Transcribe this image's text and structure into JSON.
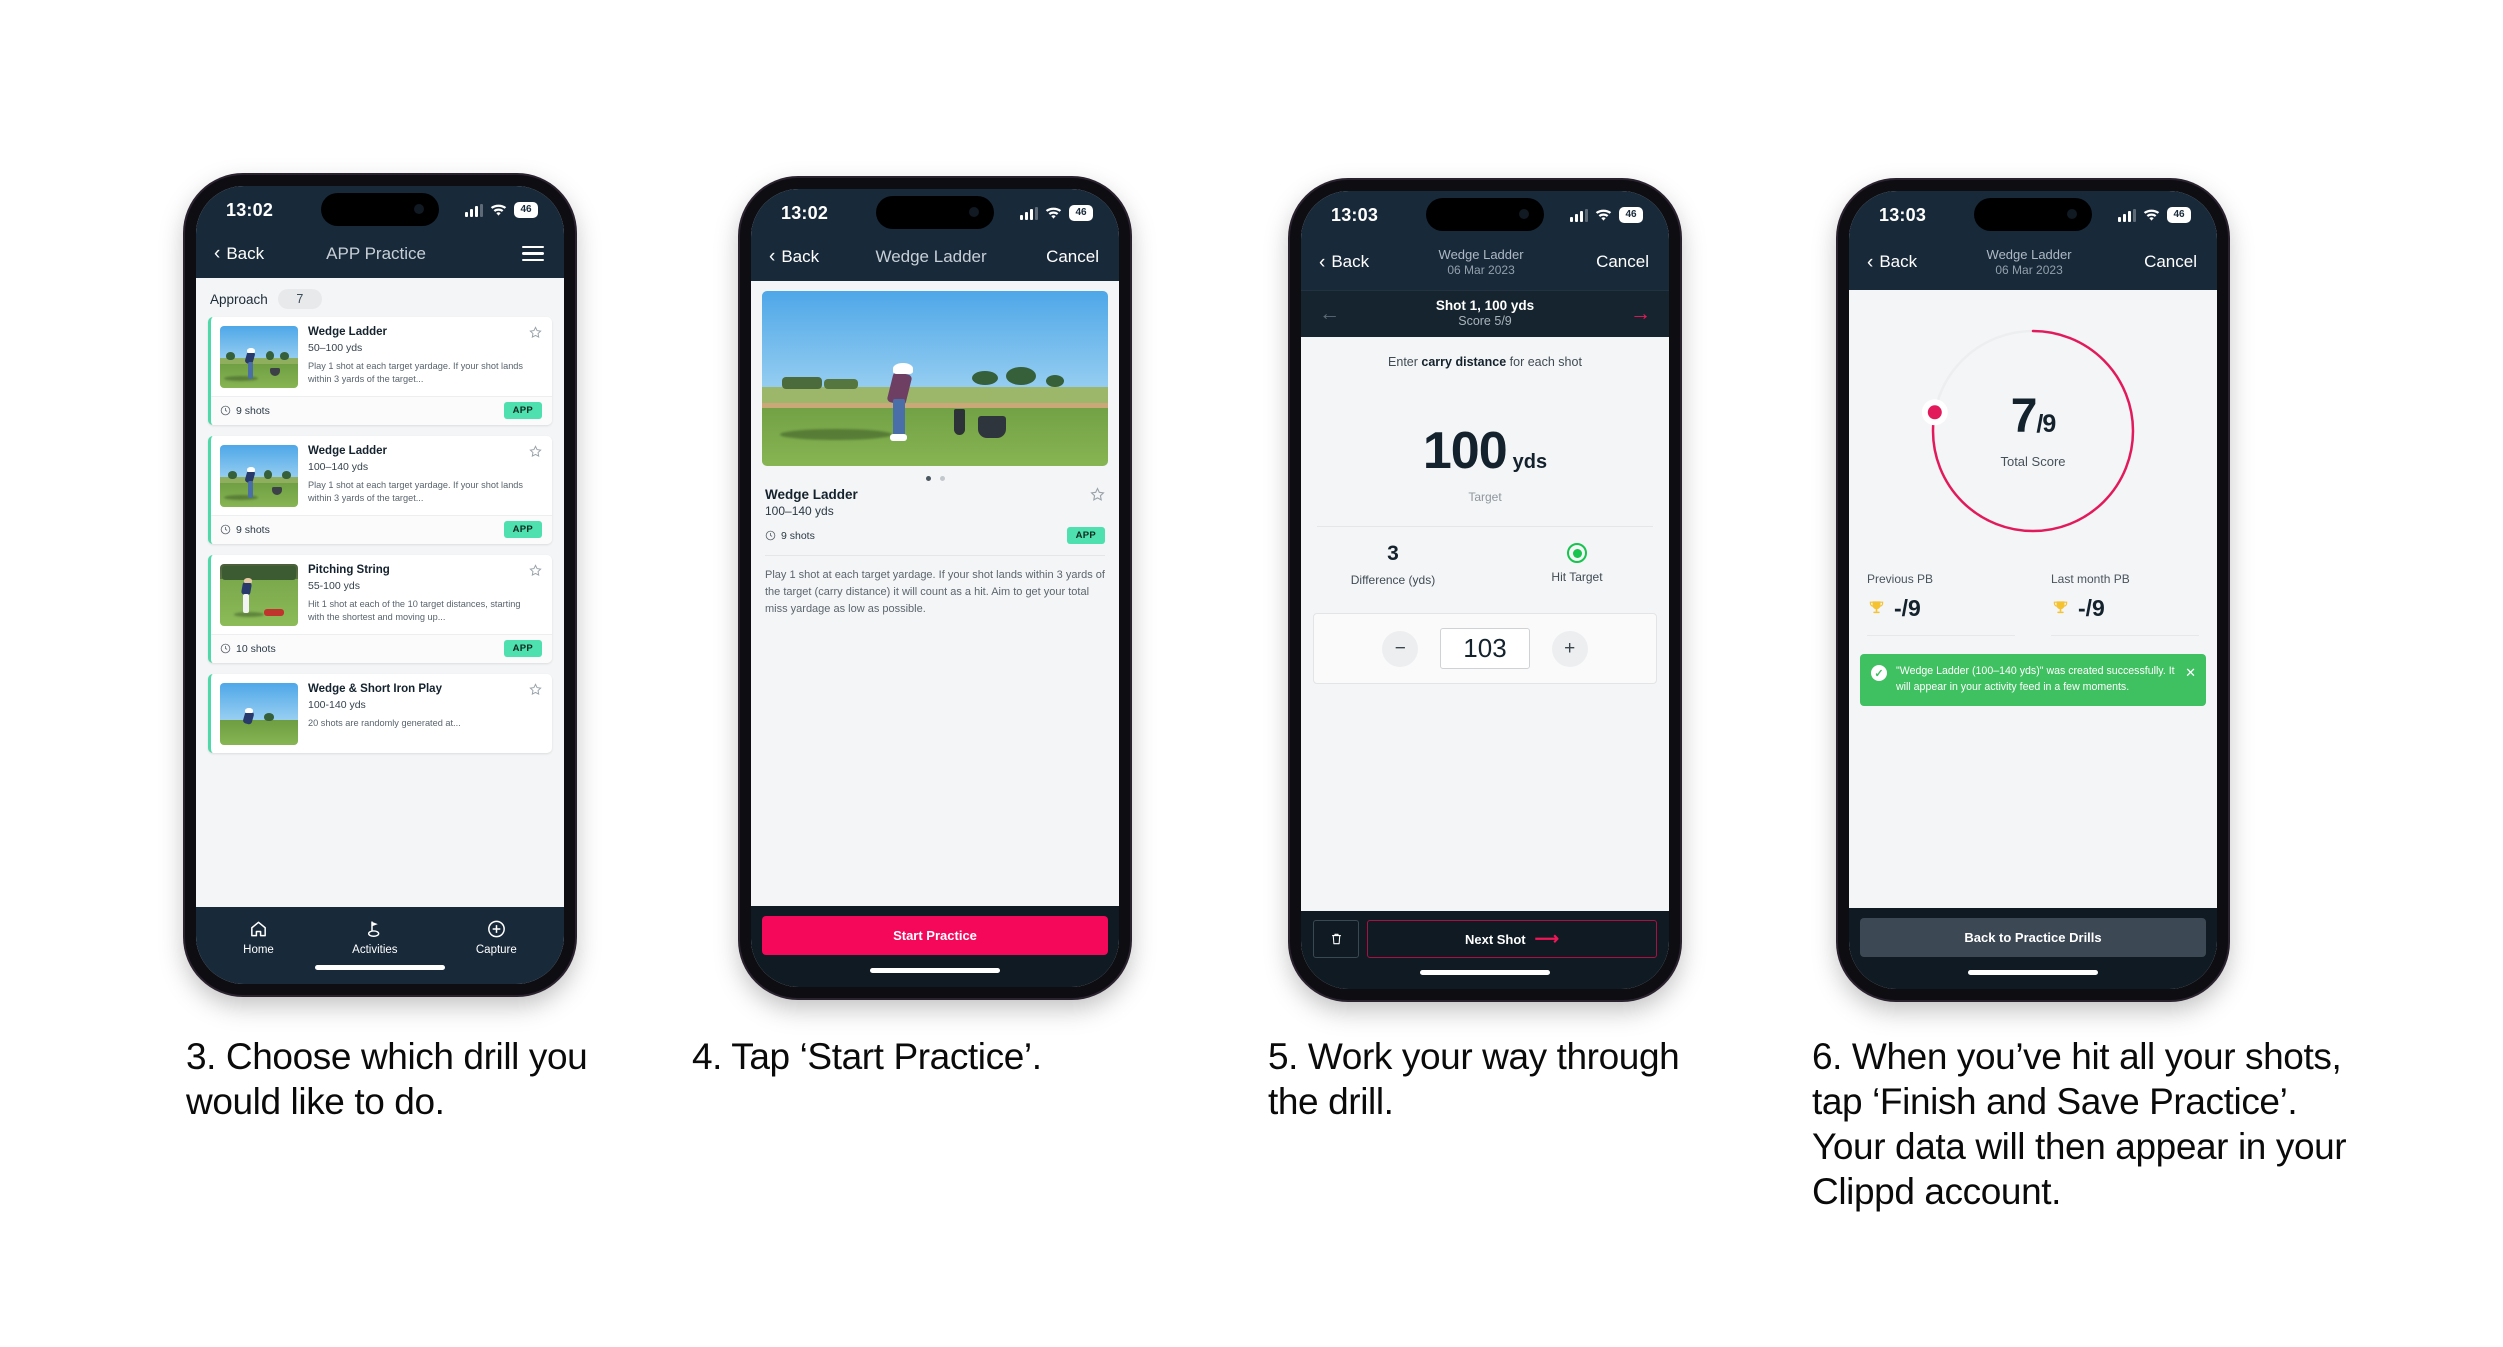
{
  "phones": [
    {
      "id": "phone-drill-list",
      "status": {
        "time": "13:02",
        "battery": "46"
      },
      "nav": {
        "back": "Back",
        "title": "APP Practice",
        "menu": "menu-icon"
      },
      "filter": {
        "label": "Approach",
        "count": "7"
      },
      "cards": [
        {
          "title": "Wedge Ladder",
          "subtitle": "50–100 yds",
          "description": "Play 1 shot at each target yardage. If your shot lands within 3 yards of the target...",
          "shots": "9 shots",
          "badge": "APP"
        },
        {
          "title": "Wedge Ladder",
          "subtitle": "100–140 yds",
          "description": "Play 1 shot at each target yardage. If your shot lands within 3 yards of the target...",
          "shots": "9 shots",
          "badge": "APP"
        },
        {
          "title": "Pitching String",
          "subtitle": "55-100 yds",
          "description": "Hit 1 shot at each of the 10 target distances, starting with the shortest and moving up...",
          "shots": "10 shots",
          "badge": "APP"
        },
        {
          "title": "Wedge & Short Iron Play",
          "subtitle": "100-140 yds",
          "description": "20 shots are randomly generated at...",
          "shots": "",
          "badge": ""
        }
      ],
      "tabs": [
        {
          "label": "Home",
          "icon": "home-icon"
        },
        {
          "label": "Activities",
          "icon": "golf-flag-icon"
        },
        {
          "label": "Capture",
          "icon": "plus-circle-icon"
        }
      ]
    },
    {
      "id": "phone-drill-detail",
      "status": {
        "time": "13:02",
        "battery": "46"
      },
      "nav": {
        "back": "Back",
        "title": "Wedge Ladder",
        "cancel": "Cancel"
      },
      "detail": {
        "title": "Wedge Ladder",
        "subtitle": "100–140 yds",
        "shots": "9 shots",
        "badge": "APP",
        "description": "Play 1 shot at each target yardage. If your shot lands within 3 yards of the target (carry distance) it will count as a hit. Aim to get your total miss yardage as low as possible."
      },
      "cta": "Start Practice"
    },
    {
      "id": "phone-shot-entry",
      "status": {
        "time": "13:03",
        "battery": "46"
      },
      "nav": {
        "back": "Back",
        "title": "Wedge Ladder",
        "subtitle": "06 Mar 2023",
        "cancel": "Cancel"
      },
      "shotbar": {
        "title": "Shot 1, 100 yds",
        "score": "Score 5/9"
      },
      "entry": {
        "hint_pre": "Enter ",
        "hint_bold": "carry distance",
        "hint_post": " for each shot",
        "target_value": "100",
        "target_unit": "yds",
        "target_label": "Target",
        "difference_value": "3",
        "difference_label": "Difference (yds)",
        "hit_label": "Hit Target",
        "stepper_value": "103",
        "minus": "−",
        "plus": "+"
      },
      "footer": {
        "delete": "trash-icon",
        "next": "Next Shot"
      }
    },
    {
      "id": "phone-summary",
      "status": {
        "time": "13:03",
        "battery": "46"
      },
      "nav": {
        "back": "Back",
        "title": "Wedge Ladder",
        "subtitle": "06 Mar 2023",
        "cancel": "Cancel"
      },
      "summary": {
        "score": "7",
        "score_total": "/9",
        "score_caption": "Total Score",
        "progress_percent": 78,
        "pbs": [
          {
            "label": "Previous PB",
            "value": "-/9"
          },
          {
            "label": "Last month PB",
            "value": "-/9"
          }
        ],
        "toast": "\"Wedge Ladder (100–140 yds)\" was created successfully. It will appear in your activity feed in a few moments.",
        "button": "Back to Practice Drills"
      }
    }
  ],
  "captions": [
    "3. Choose which drill you would like to do.",
    "4. Tap ‘Start Practice’.",
    "5. Work your way through the drill.",
    "6. When you’ve hit all your shots, tap ‘Finish and Save Practice’. Your data will then appear in your Clippd account."
  ],
  "colors": {
    "header": "#18293a",
    "accent_pink": "#f5075a",
    "accent_teal": "#4fe0b0",
    "toast_green": "#3fc061",
    "hit_green": "#16c44e"
  }
}
